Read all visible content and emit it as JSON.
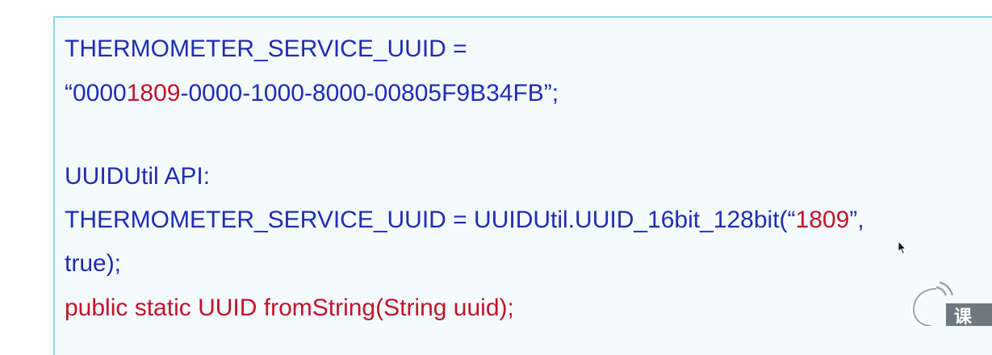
{
  "lines": {
    "l1": "THERMOMETER_SERVICE_UUID =",
    "l2_a": "“0000",
    "l2_b": "1809",
    "l2_c": "-0000-1000-8000-00805F9B34FB”;",
    "l3": "UUIDUtil API:",
    "l4_a": "THERMOMETER_SERVICE_UUID = UUIDUtil.UUID_16bit_128bit(“",
    "l4_b": "1809",
    "l4_c": "”,",
    "l5": "true);",
    "l6": "public static UUID fromString(String uuid);"
  },
  "watermark": {
    "text": "课"
  },
  "colors": {
    "code_blue": "#1f2db3",
    "highlight_red": "#c0142a",
    "panel_bg": "#f4fbfd",
    "panel_border": "#8fd4e6"
  }
}
